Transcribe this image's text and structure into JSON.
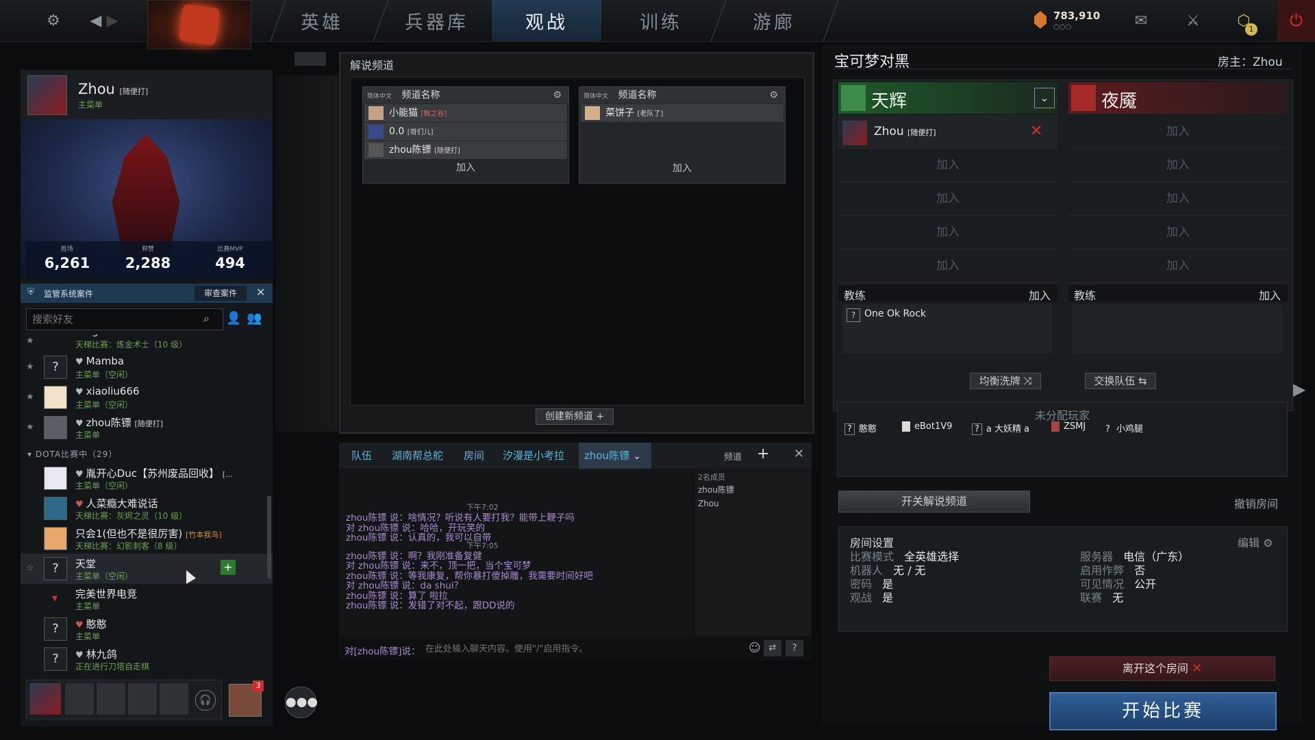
{
  "nav": {
    "tabs": [
      "英雄",
      "兵器库",
      "观战",
      "训练",
      "游廊"
    ],
    "active_tab": "观战",
    "currency": "783,910",
    "notif_count": "1"
  },
  "profile": {
    "name": "Zhou",
    "tag": "[随便打]",
    "status": "主菜单",
    "stats": [
      {
        "label": "胜场",
        "value": "6,261"
      },
      {
        "label": "称赞",
        "value": "2,288"
      },
      {
        "label": "比赛MVP",
        "value": "494"
      }
    ],
    "overwatch_label": "监管系统案件",
    "overwatch_button": "审查案件"
  },
  "friends": {
    "search_placeholder": "搜索好友",
    "partial_name": "fongdu",
    "partial_status": "天梯比赛：炼金术士（10 级）",
    "group1": [
      {
        "name": "Mamba",
        "status": "主菜单（空闲）",
        "tag": "",
        "avatar": "?",
        "rank_color": "gray"
      },
      {
        "name": "xiaoliu666",
        "status": "主菜单（空闲）",
        "tag": "",
        "avatar": "",
        "rank_color": "gray"
      },
      {
        "name": "zhou陈镖",
        "status": "主菜单",
        "tag": "[随便打]",
        "avatar": "",
        "rank_color": "gray"
      }
    ],
    "group_header": "DOTA比赛中（29）",
    "group2": [
      {
        "name": "胤开心Duc【苏州废品回收】",
        "status": "主菜单（空闲）",
        "tag": "[...",
        "avatar": ""
      },
      {
        "name": "人菜瘾大难说话",
        "status": "天梯比赛：灰烬之灵（10 级）",
        "tag": "",
        "avatar": ""
      },
      {
        "name": "只会1(但也不是很厉害)",
        "status": "天梯比赛：幻影刺客（8 级）",
        "tag": "[竹本我鸟]",
        "avatar": ""
      },
      {
        "name": "天堂",
        "status": "主菜单（空闲）",
        "tag": "",
        "avatar": "?"
      },
      {
        "name": "完美世界电竞",
        "status": "主菜单",
        "tag": "",
        "avatar": ""
      },
      {
        "name": "憨憨",
        "status": "主菜单",
        "tag": "",
        "avatar": "?"
      },
      {
        "name": "林九鸽",
        "status": "正在进行刀塔自走棋",
        "tag": "",
        "avatar": "?"
      }
    ]
  },
  "party": {
    "badge": "3"
  },
  "cast": {
    "title": "解说频道",
    "channels": [
      {
        "lang": "简体中文",
        "head": "频道名称",
        "members": [
          {
            "name": "小能猫",
            "tag": "[枫之谷]"
          },
          {
            "name": "0.0",
            "tag": "[哥们儿]"
          },
          {
            "name": "zhou陈镖",
            "tag": "[随便打]"
          }
        ],
        "join": "加入"
      },
      {
        "lang": "简体中文",
        "head": "频道名称",
        "members": [
          {
            "name": "菜饼子",
            "tag": "[老队了]"
          }
        ],
        "join": "加入"
      }
    ],
    "create_button": "创建新频道"
  },
  "chat": {
    "tabs": [
      "队伍",
      "湖南帮总舵",
      "房间",
      "汐漫是小考拉",
      "zhou陈镖"
    ],
    "channels_label": "频道",
    "member_count": "2名成员",
    "members": [
      "zhou陈镖",
      "Zhou"
    ],
    "lines": [
      {
        "type": "time",
        "text": "下午7:02"
      },
      {
        "type": "msg",
        "text": "zhou陈镖 说：啥情况？听说有人要打我？能带上鞭子吗"
      },
      {
        "type": "msg",
        "text": "对 zhou陈镖 说：哈哈，开玩笑的"
      },
      {
        "type": "msg",
        "text": "zhou陈镖 说：认真的，我可以自带"
      },
      {
        "type": "time",
        "text": "下午7:05"
      },
      {
        "type": "msg",
        "text": "zhou陈镖 说：啊？我刚准备复健"
      },
      {
        "type": "msg",
        "text": "对 zhou陈镖 说：来不，顶一把，当个宝可梦"
      },
      {
        "type": "msg",
        "text": "zhou陈镖 说：等我康复，帮你暴打傻掉雕，我需要时间好吧"
      },
      {
        "type": "msg",
        "text": "对 zhou陈镖 说：da shui？"
      },
      {
        "type": "msg",
        "text": "zhou陈镖 说：算了 啦拉"
      },
      {
        "type": "msg",
        "text": "zhou陈镖 说：发错了对不起，跟DD说的"
      }
    ],
    "input_prefix": "对[zhou陈镖]说：",
    "input_placeholder": "在此处输入聊天内容。使用\"/\"启用指令。"
  },
  "lobby": {
    "title": "宝可梦对黑",
    "host": "房主：Zhou",
    "radiant": "天辉",
    "dire": "夜魇",
    "radiant_player": {
      "name": "Zhou",
      "tag": "[随便打]"
    },
    "join": "加入",
    "coach": "教练",
    "coach_player": "One Ok Rock",
    "balance_button": "均衡洗牌",
    "swap_button": "交换队伍",
    "unassigned_title": "未分配玩家",
    "unassigned": [
      "憨憨",
      "eBot1V9",
      "a 大妖精 a",
      "ZSMJ",
      "小鸡腿"
    ],
    "toggle_cast": "开关解说频道",
    "cancel_lobby": "撤销房间",
    "settings_title": "房间设置",
    "edit": "编辑",
    "settings": [
      {
        "label": "比赛模式",
        "value": "全英雄选择"
      },
      {
        "label": "机器人",
        "value": "无 / 无"
      },
      {
        "label": "密码",
        "value": "是"
      },
      {
        "label": "观战",
        "value": "是"
      }
    ],
    "settings_right": [
      {
        "label": "服务器",
        "value": "电信（广东）"
      },
      {
        "label": "启用作弊",
        "value": "否"
      },
      {
        "label": "可见情况",
        "value": "公开"
      },
      {
        "label": "联赛",
        "value": "无"
      }
    ],
    "leave_button": "离开这个房间",
    "start_button": "开始比赛"
  }
}
